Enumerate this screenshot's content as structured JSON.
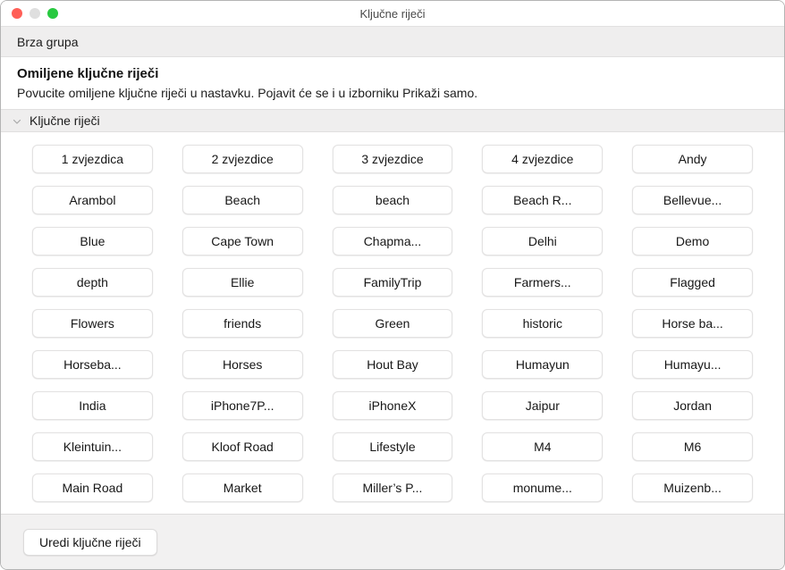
{
  "window": {
    "title": "Ključne riječi",
    "traffic_lights": [
      {
        "name": "close",
        "color": "#ff5f57"
      },
      {
        "name": "minimize",
        "color": "#dfdfdf"
      },
      {
        "name": "zoom",
        "color": "#28c940"
      }
    ]
  },
  "quick_group": {
    "label": "Brza grupa"
  },
  "favorites": {
    "title": "Omiljene ključne riječi",
    "description": "Povucite omiljene ključne riječi u nastavku. Pojavit će se i u izborniku Prikaži samo."
  },
  "section": {
    "title": "Ključne riječi",
    "disclosure_icon": "chevron-down-icon",
    "expanded": true
  },
  "keywords": [
    "1 zvjezdica",
    "2 zvjezdice",
    "3 zvjezdice",
    "4 zvjezdice",
    "Andy",
    "Arambol",
    "Beach",
    "beach",
    "Beach R...",
    "Bellevue...",
    "Blue",
    "Cape Town",
    "Chapma...",
    "Delhi",
    "Demo",
    "depth",
    "Ellie",
    "FamilyTrip",
    "Farmers...",
    "Flagged",
    "Flowers",
    "friends",
    "Green",
    "historic",
    "Horse ba...",
    "Horseba...",
    "Horses",
    "Hout Bay",
    "Humayun",
    "Humayu...",
    "India",
    "iPhone7P...",
    "iPhoneX",
    "Jaipur",
    "Jordan",
    "Kleintuin...",
    "Kloof Road",
    "Lifestyle",
    "M4",
    "M6",
    "Main Road",
    "Market",
    "Miller’s P...",
    "monume...",
    "Muizenb..."
  ],
  "footer": {
    "edit_label": "Uredi ključne riječi"
  },
  "colors": {
    "window_bg": "#ffffff",
    "bar_bg": "#efeeee",
    "footer_bg": "#f2f1f1",
    "border": "#e3e2e2",
    "text": "#171717"
  }
}
